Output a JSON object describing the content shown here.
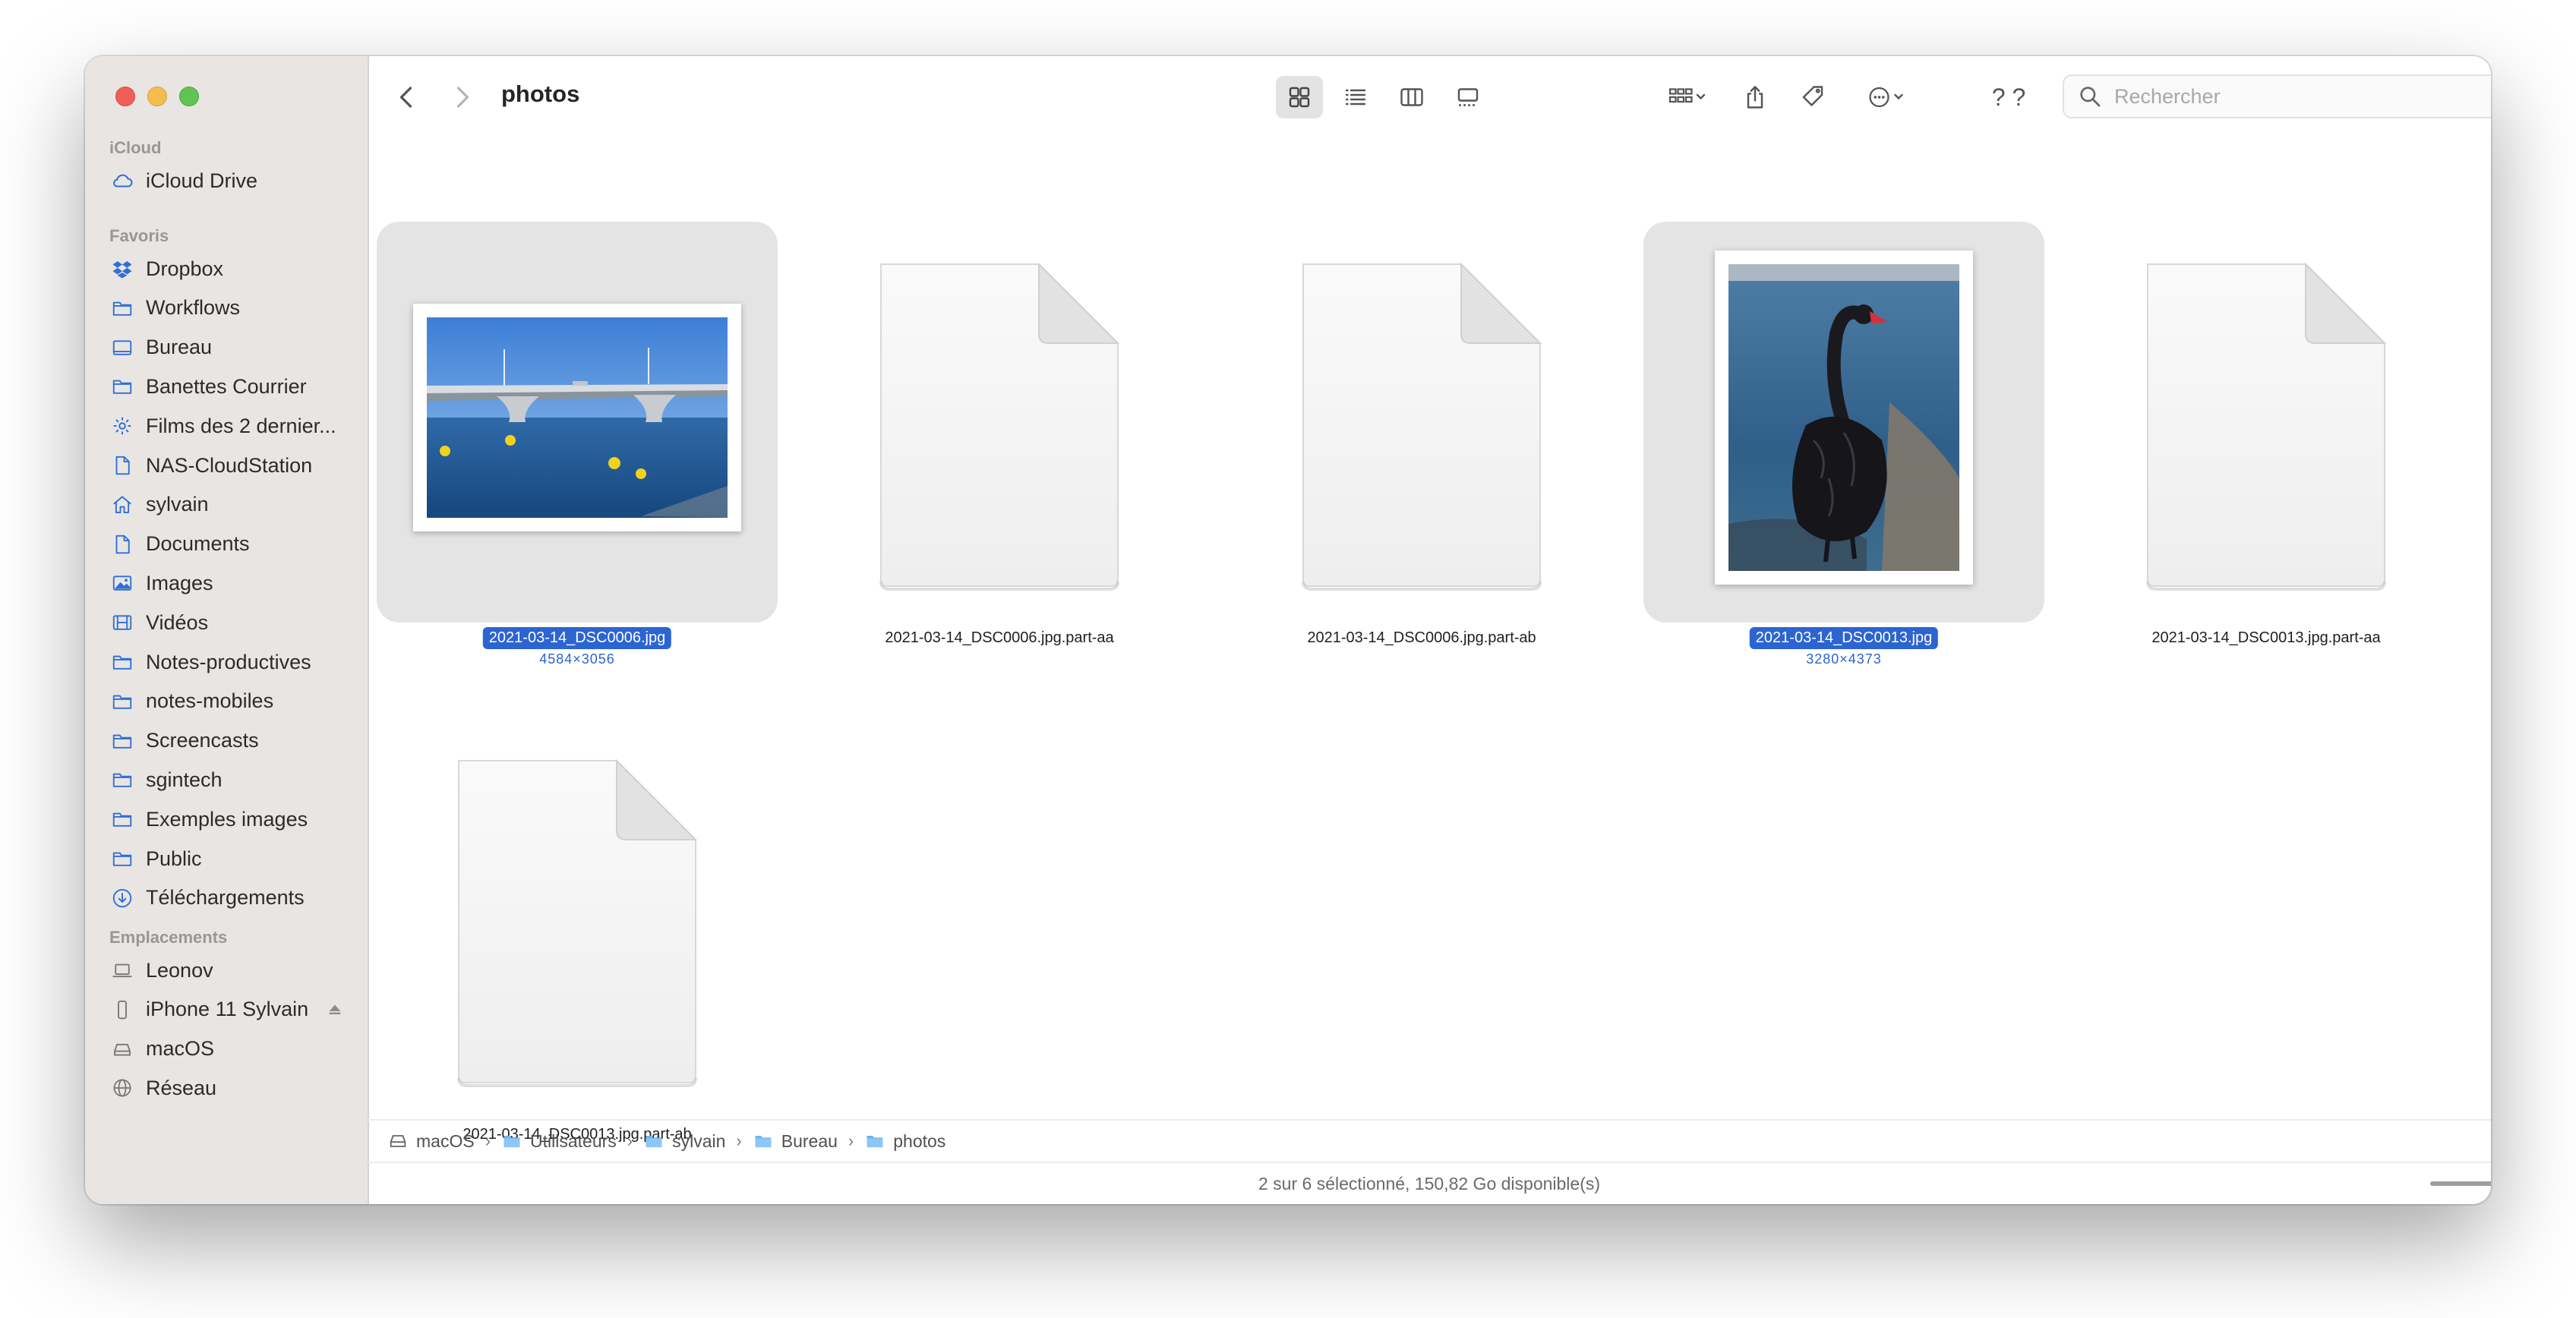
{
  "window": {
    "title": "photos"
  },
  "sidebar": {
    "sections": [
      {
        "label": "iCloud",
        "items": [
          {
            "label": "iCloud Drive",
            "icon": "cloud-icon"
          }
        ]
      },
      {
        "label": "Favoris",
        "items": [
          {
            "label": "Dropbox",
            "icon": "dropbox-icon"
          },
          {
            "label": "Workflows",
            "icon": "folder-icon"
          },
          {
            "label": "Bureau",
            "icon": "desktop-icon"
          },
          {
            "label": "Banettes Courrier",
            "icon": "folder-icon"
          },
          {
            "label": "Films des 2 dernier...",
            "icon": "gear-icon"
          },
          {
            "label": "NAS-CloudStation",
            "icon": "document-icon"
          },
          {
            "label": "sylvain",
            "icon": "home-icon"
          },
          {
            "label": "Documents",
            "icon": "document-icon"
          },
          {
            "label": "Images",
            "icon": "photo-icon"
          },
          {
            "label": "Vidéos",
            "icon": "film-icon"
          },
          {
            "label": "Notes-productives",
            "icon": "folder-icon"
          },
          {
            "label": "notes-mobiles",
            "icon": "folder-icon"
          },
          {
            "label": "Screencasts",
            "icon": "folder-icon"
          },
          {
            "label": "sgintech",
            "icon": "folder-icon"
          },
          {
            "label": "Exemples images",
            "icon": "folder-icon"
          },
          {
            "label": "Public",
            "icon": "folder-icon"
          },
          {
            "label": "Téléchargements",
            "icon": "download-icon"
          }
        ]
      },
      {
        "label": "Emplacements",
        "items": [
          {
            "label": "Leonov",
            "icon": "laptop-icon"
          },
          {
            "label": "iPhone 11 Sylvain",
            "icon": "phone-icon",
            "eject": true
          },
          {
            "label": "macOS",
            "icon": "disk-icon"
          },
          {
            "label": "Réseau",
            "icon": "globe-icon"
          }
        ]
      }
    ]
  },
  "toolbar": {
    "back": "chevron-left-icon",
    "forward": "chevron-right-icon",
    "views": [
      "icon-view-icon",
      "list-view-icon",
      "column-view-icon",
      "gallery-view-icon"
    ],
    "group": "group-icon",
    "share": "share-icon",
    "tag": "tag-icon",
    "more": "ellipsis-icon",
    "help": "? ?",
    "search_placeholder": "Rechercher"
  },
  "files": [
    {
      "name": "2021-03-14_DSC0006.jpg",
      "dims": "4584×3056",
      "selected": true,
      "kind": "photo-bridge"
    },
    {
      "name": "2021-03-14_DSC0006.jpg.part-aa",
      "selected": false,
      "kind": "generic"
    },
    {
      "name": "2021-03-14_DSC0006.jpg.part-ab",
      "selected": false,
      "kind": "generic"
    },
    {
      "name": "2021-03-14_DSC0013.jpg",
      "dims": "3280×4373",
      "selected": true,
      "kind": "photo-swan"
    },
    {
      "name": "2021-03-14_DSC0013.jpg.part-aa",
      "selected": false,
      "kind": "generic"
    },
    {
      "name": "2021-03-14_DSC0013.jpg.part-ab",
      "selected": false,
      "kind": "generic"
    }
  ],
  "pathbar": [
    "macOS",
    "Utilisateurs",
    "sylvain",
    "Bureau",
    "photos"
  ],
  "status": {
    "text": "2 sur 6 sélectionné, 150,82 Go disponible(s)",
    "icon_size_fraction": 0.62
  },
  "colors": {
    "accent": "#2c64d2",
    "sidebar_bg": "#e9e5e3",
    "sidebar_icon": "#2f6fd6"
  }
}
